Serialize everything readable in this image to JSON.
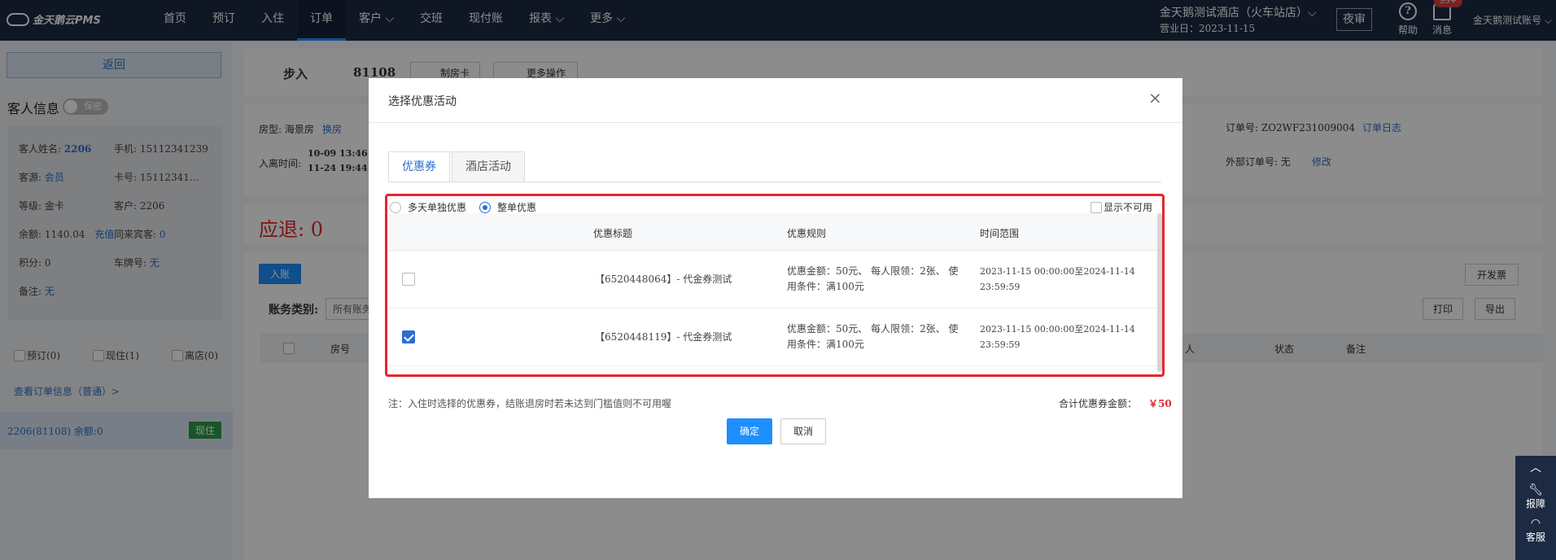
{
  "topbar": {
    "logo": "金天鹅云PMS",
    "nav": [
      "首页",
      "预订",
      "入住",
      "订单",
      "客户 ⌵",
      "交班",
      "现付账",
      "报表 ⌵",
      "更多 ⌵"
    ],
    "active_nav": "订单",
    "hotel": "金天鹅测试酒店（火车站店）⌵",
    "business_date": "营业日：2023-11-15",
    "night_audit": "夜审",
    "help": "帮助",
    "messages": "消息",
    "badge": "99+",
    "account": "金天鹅测试账号 ⌵"
  },
  "left": {
    "back": "返回",
    "guest_title": "客人信息",
    "secret_toggle": "保密",
    "fields": {
      "name_label": "客人姓名:",
      "name": "2206",
      "phone": "手机: 15112341239",
      "source_label": "客源:",
      "source": "会员",
      "card": "卡号: 15112341...",
      "level": "等级: 金卡",
      "customer": "客户: 2206",
      "balance": "余额: 1140.04",
      "recharge": "充值",
      "companions_label": "同来宾客:",
      "companions": "0",
      "points": "积分: 0",
      "plate_label": "车牌号:",
      "plate": "无",
      "remark_label": "备注:",
      "remark": "无"
    },
    "filters": [
      "预订(0)",
      "现住(1)",
      "离店(0)"
    ],
    "order_link": "查看订单信息（普通）>",
    "room_row": "2206(81108)   余额:0",
    "room_status": "现住"
  },
  "main": {
    "status": "步入",
    "order_no": "81108",
    "make_card": "制房卡",
    "more_ops": "更多操作",
    "room_type_label": "房型: 海景房",
    "change_room": "换房",
    "checkin_label": "入离时间:",
    "checkin": "10-09 13:46",
    "checkout": "11-24 19:44",
    "order_number": "订单号:  ZO2WF231009004",
    "order_log": "订单日志",
    "external_order_label": "外部订单号:  无",
    "modify": "修改",
    "refund": "应退:  0",
    "post": "入账",
    "invoice": "开发票",
    "account_type": "账务类别:",
    "account_placeholder": "所有账务",
    "print": "打印",
    "export": "导出",
    "col_room": "房号",
    "col_person": "人",
    "col_status": "状态",
    "col_remark": "备注"
  },
  "modal": {
    "title": "选择优惠活动",
    "close": "×",
    "tabs": [
      "优惠券",
      "酒店活动"
    ],
    "radio_multi": "多天单独优惠",
    "radio_whole": "整单优惠",
    "show_unavailable": "显示不可用",
    "headers": [
      "优惠标题",
      "优惠规则",
      "时间范围"
    ],
    "rows": [
      {
        "checked": false,
        "title": "【6520448064】- 代金券测试",
        "rule1": "优惠金额：50元、 每人限领：2张、 使",
        "rule2": "用条件：满100元",
        "time1": "2023-11-15 00:00:00至2024-11-14",
        "time2": "23:59:59"
      },
      {
        "checked": true,
        "title": "【6520448119】- 代金券测试",
        "rule1": "优惠金额：50元、 每人限领：2张、 使",
        "rule2": "用条件：满100元",
        "time1": "2023-11-15 00:00:00至2024-11-14",
        "time2": "23:59:59"
      }
    ],
    "note": "注：入住时选择的优惠券，结账退房时若未达到门槛值则不可用喔",
    "total_label": "合计优惠券金额：",
    "total_amount": "￥50",
    "ok": "确定",
    "cancel": "取消"
  },
  "widget": {
    "report": "报障",
    "service": "客服"
  }
}
